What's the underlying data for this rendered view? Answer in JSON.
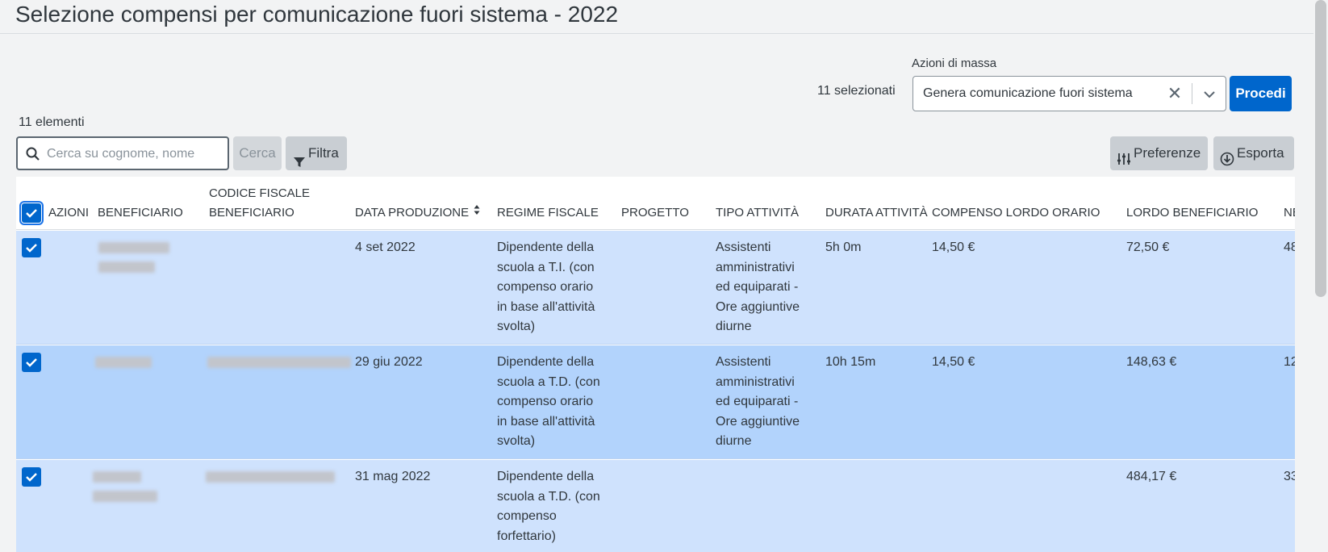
{
  "page": {
    "title": "Selezione compensi per comunicazione fuori sistema - 2022"
  },
  "mass_actions": {
    "label": "Azioni di massa",
    "selected_text": "11 selezionati",
    "selected_value": "Genera comunicazione fuori sistema",
    "clear_symbol": "✕",
    "submit_label": "Procedi"
  },
  "toolbar": {
    "count_text": "11 elementi",
    "search_placeholder": "Cerca su cognome, nome",
    "search_button": "Cerca",
    "filter_button": "Filtra",
    "preferences_button": "Preferenze",
    "export_button": "Esporta"
  },
  "table": {
    "columns": [
      "AZIONI",
      "BENEFICIARIO",
      "CODICE FISCALE",
      "BENEFICIARIO",
      "DATA PRODUZIONE",
      "REGIME FISCALE",
      "PROGETTO",
      "TIPO ATTIVITÀ",
      "DURATA ATTIVITÀ",
      "COMPENSO LORDO ORARIO",
      "LORDO BENEFICIARIO",
      "NE"
    ],
    "rows": [
      {
        "data_produzione": "4 set 2022",
        "regime_fiscale": [
          "Dipendente della",
          "scuola a T.I. (con",
          "compenso orario",
          "in base all'attività",
          "svolta)"
        ],
        "tipo_attivita": [
          "Assistenti",
          "amministrativi",
          "ed equiparati -",
          "Ore aggiuntive",
          "diurne"
        ],
        "durata": "5h 0m",
        "compenso_orario": "14,50 €",
        "lordo_beneficiario": "72,50 €",
        "netto_partial": "48"
      },
      {
        "data_produzione": "29 giu 2022",
        "regime_fiscale": [
          "Dipendente della",
          "scuola a T.D. (con",
          "compenso orario",
          "in base all'attività",
          "svolta)"
        ],
        "tipo_attivita": [
          "Assistenti",
          "amministrativi",
          "ed equiparati -",
          "Ore aggiuntive",
          "diurne"
        ],
        "durata": "10h 15m",
        "compenso_orario": "14,50 €",
        "lordo_beneficiario": "148,63 €",
        "netto_partial": "12"
      },
      {
        "data_produzione": "31 mag 2022",
        "regime_fiscale": [
          "Dipendente della",
          "scuola a T.D. (con",
          "compenso",
          "forfettario)"
        ],
        "tipo_attivita": [],
        "durata": "",
        "compenso_orario": "",
        "lordo_beneficiario": "484,17 €",
        "netto_partial": "33"
      }
    ]
  },
  "colors": {
    "primary": "#0066cc",
    "row_selected": "#cfe2fd",
    "row_hover": "#b2d3fc"
  }
}
